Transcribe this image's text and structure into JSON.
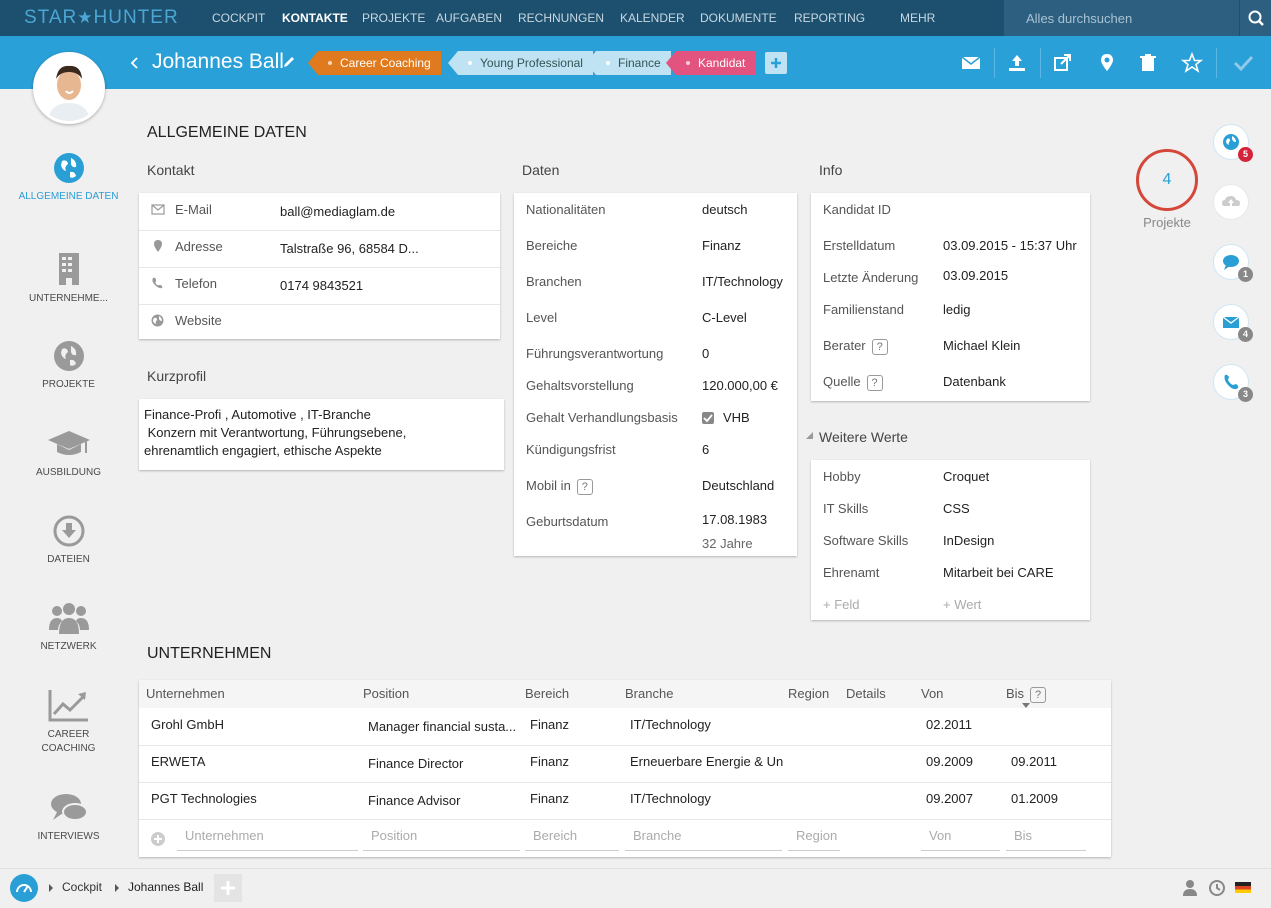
{
  "app": {
    "logo_left": "STAR",
    "logo_right": "HUNTER"
  },
  "topnav": {
    "items": [
      "COCKPIT",
      "KONTAKTE",
      "PROJEKTE",
      "AUFGABEN",
      "RECHNUNGEN",
      "KALENDER",
      "DOKUMENTE",
      "REPORTING",
      "MEHR"
    ],
    "active": "KONTAKTE"
  },
  "search": {
    "placeholder": "Alles durchsuchen"
  },
  "profile": {
    "name": "Johannes Ball"
  },
  "tags": [
    {
      "label": "Career Coaching",
      "color": "#e07a1f"
    },
    {
      "label": "Young Professional",
      "color": "#bfe3f2"
    },
    {
      "label": "Finance",
      "color": "#bfe3f2"
    },
    {
      "label": "Kandidat",
      "color": "#e2547f"
    }
  ],
  "sidebar": {
    "items": [
      {
        "label": "ALLGEMEINE DATEN"
      },
      {
        "label": "UNTERNEHME..."
      },
      {
        "label": "PROJEKTE"
      },
      {
        "label": "AUSBILDUNG"
      },
      {
        "label": "DATEIEN"
      },
      {
        "label": "NETZWERK"
      },
      {
        "label": "CAREER COACHING"
      },
      {
        "label": "INTERVIEWS"
      }
    ]
  },
  "section_title": "ALLGEMEINE DATEN",
  "kontakt": {
    "title": "Kontakt",
    "rows": [
      {
        "label": "E-Mail",
        "value": "ball@mediaglam.de"
      },
      {
        "label": "Adresse",
        "value": "Talstraße 96, 68584 D..."
      },
      {
        "label": "Telefon",
        "value": "0174 9843521"
      },
      {
        "label": "Website",
        "value": ""
      }
    ]
  },
  "kurzprofil": {
    "title": "Kurzprofil",
    "lines": [
      "Finance-Profi , Automotive , IT-Branche",
      " Konzern mit Verantwortung, Führungsebene,",
      "ehrenamtlich engagiert, ethische Aspekte"
    ]
  },
  "daten": {
    "title": "Daten",
    "rows": [
      {
        "label": "Nationalitäten",
        "value": "deutsch"
      },
      {
        "label": "Bereiche",
        "value": "Finanz"
      },
      {
        "label": "Branchen",
        "value": "IT/Technology"
      },
      {
        "label": "Level",
        "value": "C-Level"
      },
      {
        "label": "Führungsverantwortung",
        "value": "0"
      },
      {
        "label": "Gehaltsvorstellung",
        "value": "120.000,00 €"
      },
      {
        "label": "Gehalt Verhandlungsbasis",
        "value": "VHB"
      },
      {
        "label": "Kündigungsfrist",
        "value": "6"
      },
      {
        "label": "Mobil in",
        "value": "Deutschland"
      },
      {
        "label": "Geburtsdatum",
        "value": "17.08.1983",
        "sub": "32 Jahre"
      }
    ]
  },
  "info": {
    "title": "Info",
    "rows": [
      {
        "label": "Kandidat ID",
        "value": ""
      },
      {
        "label": "Erstelldatum",
        "value": "03.09.2015 - 15:37 Uhr"
      },
      {
        "label": "Letzte Änderung",
        "value": "03.09.2015"
      },
      {
        "label": "Familienstand",
        "value": "ledig"
      },
      {
        "label": "Berater",
        "value": "Michael Klein"
      },
      {
        "label": "Quelle",
        "value": "Datenbank"
      }
    ]
  },
  "weitere": {
    "title": "Weitere Werte",
    "rows": [
      {
        "label": "Hobby",
        "value": "Croquet"
      },
      {
        "label": "IT Skills",
        "value": "CSS"
      },
      {
        "label": "Software Skills",
        "value": "InDesign"
      },
      {
        "label": "Ehrenamt",
        "value": "Mitarbeit bei CARE"
      }
    ],
    "add_field": "+ Feld",
    "add_value": "+ Wert"
  },
  "projekte_count": {
    "value": "4",
    "label": "Projekte"
  },
  "unternehmen": {
    "title": "UNTERNEHMEN",
    "headers": [
      "Unternehmen",
      "Position",
      "Bereich",
      "Branche",
      "Region",
      "Details",
      "Von",
      "Bis"
    ],
    "rows": [
      [
        "Grohl GmbH",
        "Manager financial susta...",
        "Finanz",
        "IT/Technology",
        "",
        "",
        "02.2011",
        ""
      ],
      [
        "ERWETA",
        "Finance Director",
        "Finanz",
        "Erneuerbare Energie & Un",
        "",
        "",
        "09.2009",
        "09.2011"
      ],
      [
        "PGT Technologies",
        "Finance Advisor",
        "Finanz",
        "IT/Technology",
        "",
        "",
        "09.2007",
        "01.2009"
      ]
    ],
    "placeholders": [
      "Unternehmen",
      "Position",
      "Bereich",
      "Branche",
      "Region",
      "Von",
      "Bis"
    ]
  },
  "right_badges": {
    "projects": "5",
    "chat": "1",
    "mail": "4",
    "phone": "3"
  },
  "breadcrumb": [
    "Cockpit",
    "Johannes Ball"
  ],
  "colors": {
    "nav": "#1d4f6e",
    "accent": "#2aa0d8",
    "ring": "#d4473a"
  }
}
